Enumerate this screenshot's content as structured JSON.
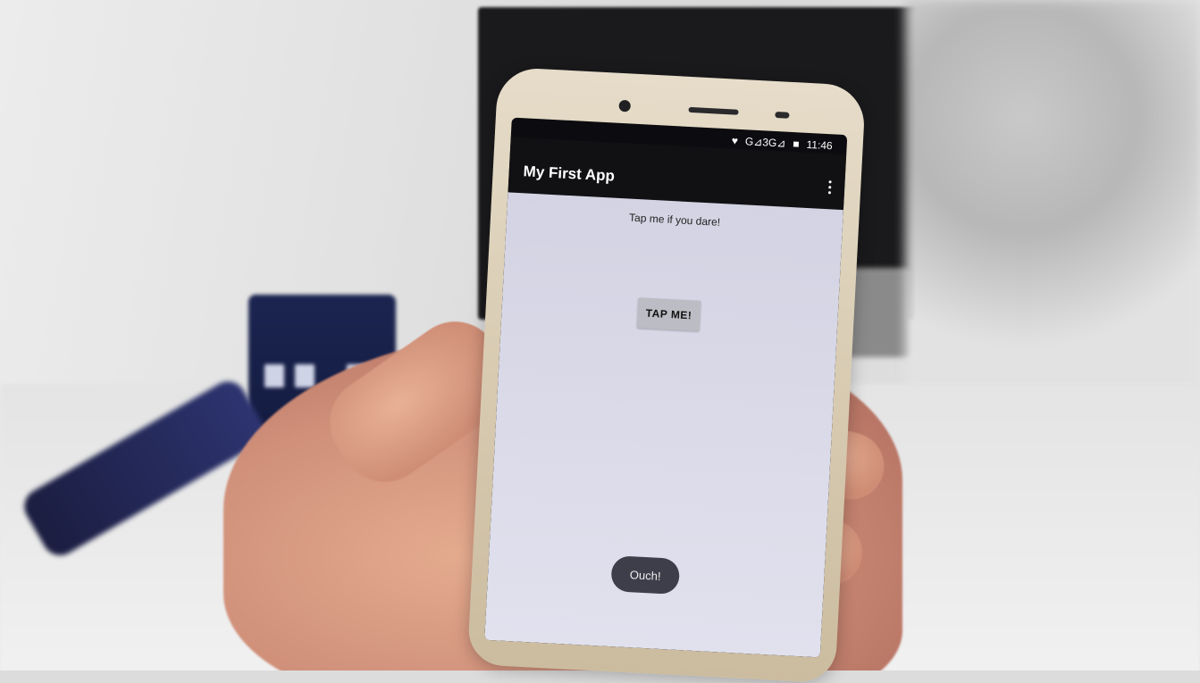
{
  "app": {
    "title": "My First App",
    "status": {
      "network": "G⊿3G⊿",
      "battery": "■",
      "time": "11:46"
    }
  },
  "content": {
    "prompt_text": "Tap me if you dare!",
    "button_label": "TAP ME!",
    "toast_text": "Ouch!"
  },
  "icons": {
    "overflow": "more-vert-icon",
    "wifi": "wifi-icon",
    "battery": "battery-icon"
  }
}
